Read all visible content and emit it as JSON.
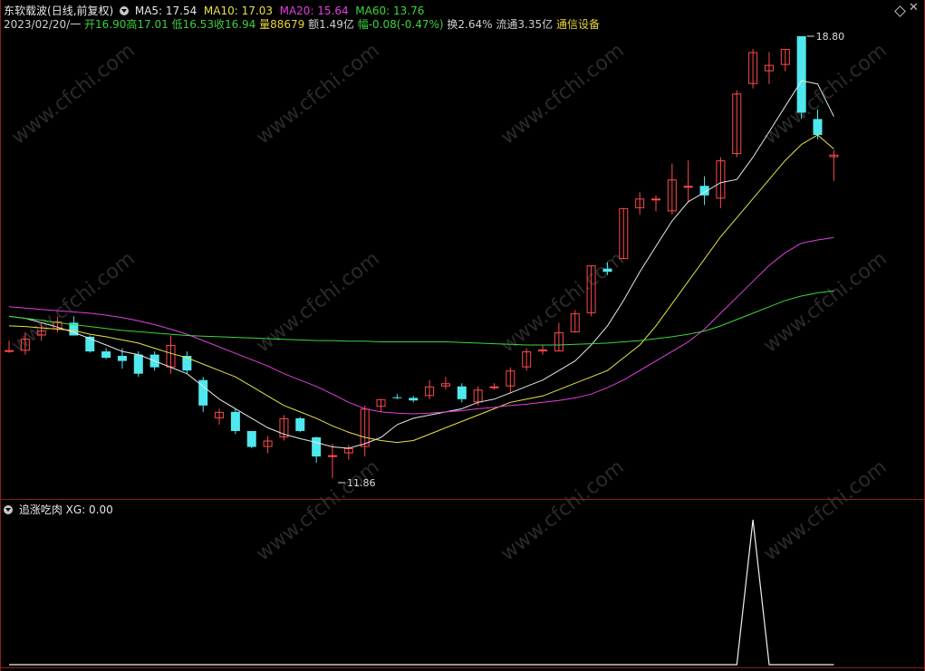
{
  "header": {
    "stock_name": "东软载波",
    "period": "(日线,前复权)",
    "ma5": "MA5: 17.54",
    "ma10": "MA10: 17.03",
    "ma20": "MA20: 15.64",
    "ma60": "MA60: 13.76",
    "date": "2023/02/20/一",
    "open": "开16.90",
    "high": "高17.01",
    "low": "低16.53",
    "close": "收16.94",
    "volume": "量88679",
    "amount": "额1.49亿",
    "change": "幅-0.08(-0.47%)",
    "turnover": "换2.64%",
    "float": "流通3.35亿",
    "sector": "通信设备"
  },
  "indicator": {
    "name": "追涨吃肉",
    "value": "XG: 0.00"
  },
  "watermark": "www.cfchi.com",
  "colors": {
    "up": "#ff4a4a",
    "down": "#4fe8ee",
    "ma5": "#e6e6e6",
    "ma10": "#e8e24a",
    "ma20": "#e040e0",
    "ma60": "#3dd63d",
    "border": "#8a1e1e"
  },
  "chart_data": [
    {
      "type": "candlestick",
      "label_high": "18.80",
      "label_low": "11.86",
      "ylim": [
        11.3,
        19.3
      ],
      "candles": [
        {
          "o": 13.85,
          "h": 14.02,
          "l": 13.83,
          "c": 13.87
        },
        {
          "o": 13.86,
          "h": 14.15,
          "l": 13.8,
          "c": 14.05
        },
        {
          "o": 14.1,
          "h": 14.3,
          "l": 14.02,
          "c": 14.18
        },
        {
          "o": 14.2,
          "h": 14.4,
          "l": 14.15,
          "c": 14.32
        },
        {
          "o": 14.3,
          "h": 14.4,
          "l": 14.1,
          "c": 14.1
        },
        {
          "o": 14.08,
          "h": 14.1,
          "l": 13.83,
          "c": 13.85
        },
        {
          "o": 13.85,
          "h": 13.9,
          "l": 13.73,
          "c": 13.75
        },
        {
          "o": 13.78,
          "h": 13.9,
          "l": 13.58,
          "c": 13.7
        },
        {
          "o": 13.8,
          "h": 13.85,
          "l": 13.45,
          "c": 13.5
        },
        {
          "o": 13.8,
          "h": 13.85,
          "l": 13.55,
          "c": 13.6
        },
        {
          "o": 13.6,
          "h": 14.1,
          "l": 13.5,
          "c": 13.95
        },
        {
          "o": 13.78,
          "h": 13.85,
          "l": 13.5,
          "c": 13.55
        },
        {
          "o": 13.4,
          "h": 13.45,
          "l": 12.9,
          "c": 13.0
        },
        {
          "o": 12.8,
          "h": 12.95,
          "l": 12.7,
          "c": 12.9
        },
        {
          "o": 12.9,
          "h": 12.95,
          "l": 12.55,
          "c": 12.6
        },
        {
          "o": 12.6,
          "h": 12.6,
          "l": 12.33,
          "c": 12.35
        },
        {
          "o": 12.35,
          "h": 12.52,
          "l": 12.25,
          "c": 12.45
        },
        {
          "o": 12.5,
          "h": 12.85,
          "l": 12.45,
          "c": 12.8
        },
        {
          "o": 12.8,
          "h": 12.82,
          "l": 12.58,
          "c": 12.6
        },
        {
          "o": 12.5,
          "h": 12.51,
          "l": 12.1,
          "c": 12.2
        },
        {
          "o": 12.2,
          "h": 12.4,
          "l": 11.86,
          "c": 12.22
        },
        {
          "o": 12.25,
          "h": 12.38,
          "l": 12.15,
          "c": 12.33
        },
        {
          "o": 12.35,
          "h": 13.0,
          "l": 12.2,
          "c": 12.95
        },
        {
          "o": 12.98,
          "h": 13.1,
          "l": 12.9,
          "c": 13.1
        },
        {
          "o": 13.13,
          "h": 13.18,
          "l": 13.1,
          "c": 13.12
        },
        {
          "o": 13.12,
          "h": 13.15,
          "l": 13.05,
          "c": 13.08
        },
        {
          "o": 13.15,
          "h": 13.4,
          "l": 13.1,
          "c": 13.3
        },
        {
          "o": 13.3,
          "h": 13.45,
          "l": 13.25,
          "c": 13.35
        },
        {
          "o": 13.3,
          "h": 13.35,
          "l": 13.05,
          "c": 13.1
        },
        {
          "o": 13.05,
          "h": 13.3,
          "l": 13.0,
          "c": 13.25
        },
        {
          "o": 13.3,
          "h": 13.35,
          "l": 13.25,
          "c": 13.3
        },
        {
          "o": 13.3,
          "h": 13.6,
          "l": 13.2,
          "c": 13.55
        },
        {
          "o": 13.6,
          "h": 13.9,
          "l": 13.55,
          "c": 13.85
        },
        {
          "o": 13.85,
          "h": 13.95,
          "l": 13.8,
          "c": 13.88
        },
        {
          "o": 13.85,
          "h": 14.3,
          "l": 13.85,
          "c": 14.15
        },
        {
          "o": 14.15,
          "h": 14.5,
          "l": 14.15,
          "c": 14.45
        },
        {
          "o": 14.45,
          "h": 15.2,
          "l": 14.4,
          "c": 15.2
        },
        {
          "o": 15.15,
          "h": 15.25,
          "l": 15.05,
          "c": 15.1
        },
        {
          "o": 15.3,
          "h": 16.1,
          "l": 15.3,
          "c": 16.1
        },
        {
          "o": 16.1,
          "h": 16.35,
          "l": 16.0,
          "c": 16.25
        },
        {
          "o": 16.25,
          "h": 16.3,
          "l": 16.05,
          "c": 16.25
        },
        {
          "o": 16.05,
          "h": 16.8,
          "l": 16.0,
          "c": 16.55
        },
        {
          "o": 16.45,
          "h": 16.85,
          "l": 16.2,
          "c": 16.45
        },
        {
          "o": 16.45,
          "h": 16.6,
          "l": 16.15,
          "c": 16.3
        },
        {
          "o": 16.25,
          "h": 16.9,
          "l": 16.1,
          "c": 16.85
        },
        {
          "o": 16.95,
          "h": 17.95,
          "l": 16.9,
          "c": 17.9
        },
        {
          "o": 18.05,
          "h": 18.6,
          "l": 17.98,
          "c": 18.55
        },
        {
          "o": 18.25,
          "h": 18.55,
          "l": 18.05,
          "c": 18.35
        },
        {
          "o": 18.35,
          "h": 18.6,
          "l": 18.25,
          "c": 18.6
        },
        {
          "o": 18.8,
          "h": 18.8,
          "l": 17.5,
          "c": 17.6
        },
        {
          "o": 17.5,
          "h": 17.65,
          "l": 17.18,
          "c": 17.25
        },
        {
          "o": 16.9,
          "h": 17.01,
          "l": 16.53,
          "c": 16.94
        }
      ],
      "series": [
        {
          "name": "MA5",
          "values": [
            14.4,
            14.37,
            14.3,
            14.23,
            14.15,
            14.05,
            13.95,
            13.85,
            13.8,
            13.7,
            13.6,
            13.5,
            13.3,
            13.1,
            12.95,
            12.8,
            12.65,
            12.55,
            12.48,
            12.42,
            12.35,
            12.33,
            12.4,
            12.5,
            12.7,
            12.8,
            12.85,
            12.9,
            12.95,
            13.05,
            13.1,
            13.2,
            13.3,
            13.4,
            13.55,
            13.7,
            13.95,
            14.25,
            14.65,
            15.1,
            15.5,
            15.9,
            16.2,
            16.35,
            16.5,
            16.55,
            16.9,
            17.3,
            17.7,
            18.1,
            18.05,
            17.54
          ]
        },
        {
          "name": "MA10",
          "values": [
            14.25,
            14.24,
            14.22,
            14.2,
            14.18,
            14.12,
            14.08,
            14.03,
            13.98,
            13.9,
            13.82,
            13.75,
            13.65,
            13.55,
            13.45,
            13.3,
            13.15,
            13.0,
            12.9,
            12.8,
            12.68,
            12.58,
            12.5,
            12.45,
            12.42,
            12.45,
            12.55,
            12.65,
            12.75,
            12.85,
            12.95,
            13.05,
            13.1,
            13.15,
            13.25,
            13.35,
            13.45,
            13.55,
            13.75,
            13.95,
            14.25,
            14.6,
            14.95,
            15.3,
            15.65,
            15.95,
            16.25,
            16.55,
            16.85,
            17.1,
            17.25,
            17.03
          ]
        },
        {
          "name": "MA20",
          "values": [
            14.55,
            14.53,
            14.51,
            14.49,
            14.47,
            14.45,
            14.42,
            14.38,
            14.33,
            14.27,
            14.2,
            14.12,
            14.02,
            13.92,
            13.82,
            13.72,
            13.62,
            13.5,
            13.4,
            13.3,
            13.18,
            13.05,
            12.95,
            12.9,
            12.88,
            12.87,
            12.88,
            12.9,
            12.92,
            12.95,
            12.97,
            13.0,
            13.02,
            13.05,
            13.08,
            13.12,
            13.18,
            13.28,
            13.4,
            13.55,
            13.7,
            13.85,
            14.0,
            14.2,
            14.45,
            14.7,
            14.95,
            15.2,
            15.4,
            15.55,
            15.6,
            15.64
          ]
        },
        {
          "name": "MA60",
          "values": [
            14.4,
            14.37,
            14.34,
            14.3,
            14.27,
            14.24,
            14.21,
            14.18,
            14.16,
            14.14,
            14.12,
            14.1,
            14.09,
            14.08,
            14.07,
            14.06,
            14.05,
            14.04,
            14.03,
            14.02,
            14.02,
            14.01,
            14.01,
            14.0,
            14.0,
            14.0,
            14.0,
            14.0,
            13.99,
            13.98,
            13.97,
            13.96,
            13.95,
            13.95,
            13.95,
            13.96,
            13.97,
            13.98,
            14.0,
            14.02,
            14.05,
            14.08,
            14.12,
            14.17,
            14.25,
            14.35,
            14.45,
            14.55,
            14.65,
            14.72,
            14.77,
            14.8
          ]
        }
      ]
    },
    {
      "type": "line",
      "name": "XG",
      "ylim": [
        0,
        1
      ],
      "values": [
        0,
        0,
        0,
        0,
        0,
        0,
        0,
        0,
        0,
        0,
        0,
        0,
        0,
        0,
        0,
        0,
        0,
        0,
        0,
        0,
        0,
        0,
        0,
        0,
        0,
        0,
        0,
        0,
        0,
        0,
        0,
        0,
        0,
        0,
        0,
        0,
        0,
        0,
        0,
        0,
        0,
        0,
        0,
        0,
        0,
        0,
        1,
        0,
        0,
        0,
        0,
        0
      ]
    }
  ]
}
